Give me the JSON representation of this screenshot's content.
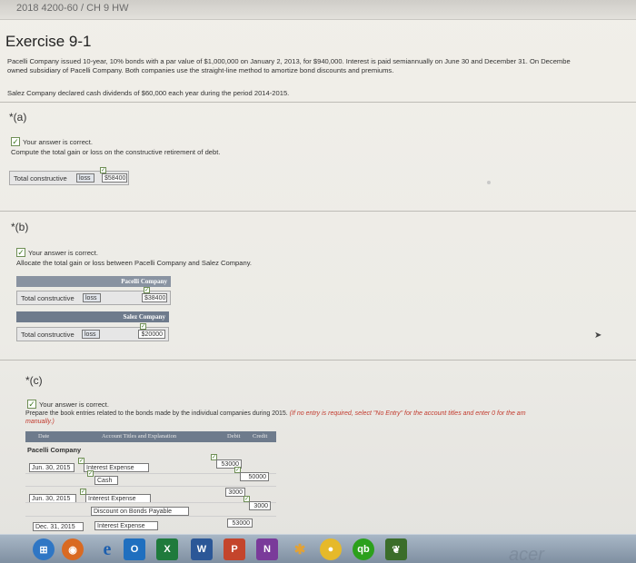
{
  "top_strip": "2018 4200-60 / CH 9 HW",
  "exercise_title": "Exercise 9-1",
  "problem": {
    "line1": "Pacelli Company issued 10-year, 10% bonds with a par value of $1,000,000 on January 2, 2013, for $940,000. Interest is paid semiannually on June 30 and December 31. On Decembe",
    "line2": "owned subsidiary of Pacelli Company. Both companies use the straight-line method to amortize bond discounts and premiums.",
    "line3": "Salez Company declared cash dividends of $60,000 each year during the period 2014-2015."
  },
  "parts": {
    "a": {
      "label": "*(a)",
      "correct": "Your answer is correct.",
      "instruction": "Compute the total gain or loss on the constructive retirement of debt.",
      "row_label": "Total constructive",
      "select": "loss",
      "value": "$58400"
    },
    "b": {
      "label": "*(b)",
      "correct": "Your answer is correct.",
      "instruction": "Allocate the total gain or loss between Pacelli Company and Salez Company.",
      "pacelli_header": "Pacelli Company",
      "salez_header": "Salez Company",
      "row_label": "Total constructive",
      "pacelli_select": "loss",
      "pacelli_value": "$38400",
      "salez_select": "loss",
      "salez_value": "$20000"
    },
    "c": {
      "label": "*(c)",
      "correct": "Your answer is correct.",
      "instruction": "Prepare the book entries related to the bonds made by the individual companies during 2015.",
      "note": "(If no entry is required, select \"No Entry\" for the account titles and enter 0 for the am",
      "note2": "manually.)",
      "col_date": "Date",
      "col_account": "Account Titles and Explanation",
      "col_debit": "Debit",
      "col_credit": "Credit",
      "company": "Pacelli Company",
      "rows": [
        {
          "date": "Jun. 30, 2015",
          "account": "Interest Expense",
          "debit": "53000",
          "credit": "0"
        },
        {
          "date": "",
          "account": "Cash",
          "debit": "0",
          "credit": "50000"
        },
        {
          "date": "Jun. 30, 2015",
          "account": "Interest Expense",
          "debit": "3000",
          "credit": "0"
        },
        {
          "date": "",
          "account": "Discount on Bonds Payable",
          "debit": "0",
          "credit": "3000"
        },
        {
          "date": "Dec. 31, 2015",
          "account": "Interest Expense",
          "debit": "53000",
          "credit": "0"
        }
      ]
    }
  },
  "taskbar": {
    "icons": [
      "windows-start",
      "firefox",
      "ie",
      "outlook",
      "excel",
      "word",
      "powerpoint",
      "onenote",
      "slack",
      "chrome",
      "quickbooks",
      "leaf"
    ]
  },
  "brand_watermark": "acer",
  "colors": {
    "header": "#6e7b8c",
    "check_green": "#3f7a22",
    "note_red": "#c23b2e"
  }
}
